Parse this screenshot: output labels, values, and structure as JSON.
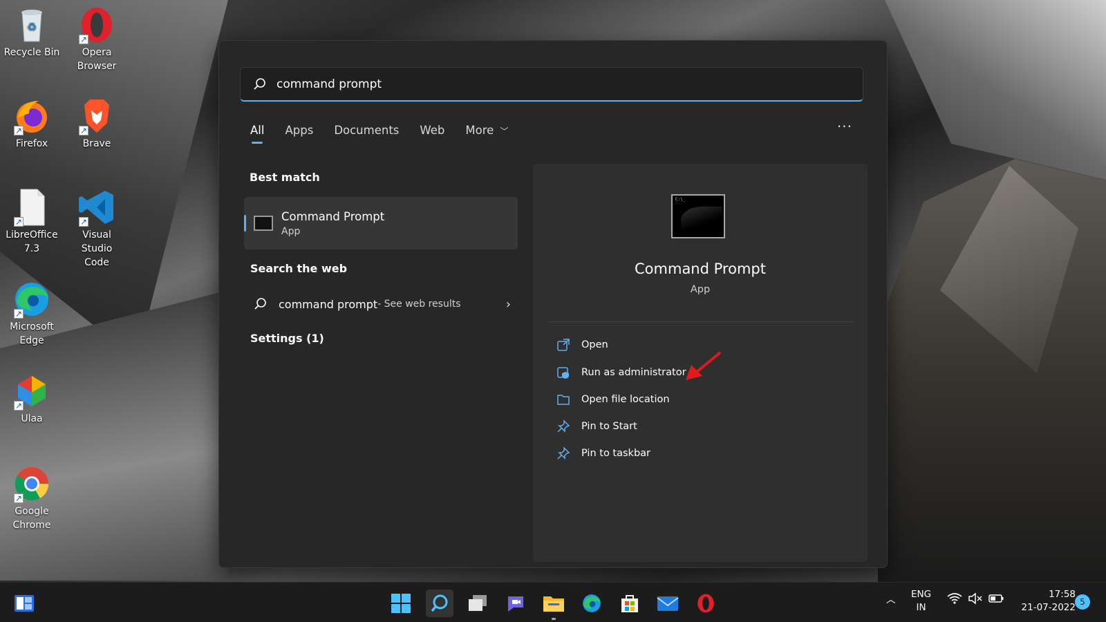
{
  "desktop": {
    "icons": [
      {
        "label_line1": "Recycle Bin",
        "label_line2": ""
      },
      {
        "label_line1": "Opera",
        "label_line2": "Browser"
      },
      {
        "label_line1": "Firefox",
        "label_line2": ""
      },
      {
        "label_line1": "Brave",
        "label_line2": ""
      },
      {
        "label_line1": "LibreOffice",
        "label_line2": "7.3"
      },
      {
        "label_line1": "Visual Studio",
        "label_line2": "Code"
      },
      {
        "label_line1": "Microsoft",
        "label_line2": "Edge"
      },
      {
        "label_line1": "Ulaa",
        "label_line2": ""
      },
      {
        "label_line1": "Google",
        "label_line2": "Chrome"
      }
    ]
  },
  "search": {
    "query": "command prompt",
    "tabs": [
      "All",
      "Apps",
      "Documents",
      "Web",
      "More"
    ],
    "more_options": "···",
    "best_match_heading": "Best match",
    "best_match": {
      "name": "Command Prompt",
      "type": "App"
    },
    "web_heading": "Search the web",
    "web_query": "command prompt",
    "web_hint": " - See web results",
    "settings_heading": "Settings (1)"
  },
  "detail": {
    "name": "Command Prompt",
    "type": "App",
    "actions": [
      "Open",
      "Run as administrator",
      "Open file location",
      "Pin to Start",
      "Pin to taskbar"
    ]
  },
  "tray": {
    "lang_line1": "ENG",
    "lang_line2": "IN",
    "time": "17:58",
    "date": "21-07-2022",
    "notification_count": "5"
  },
  "colors": {
    "accent": "#5fb2f2",
    "panel_bg": "#272727",
    "detail_bg": "#2f2f2f",
    "annotation_arrow": "#e01b1b"
  }
}
